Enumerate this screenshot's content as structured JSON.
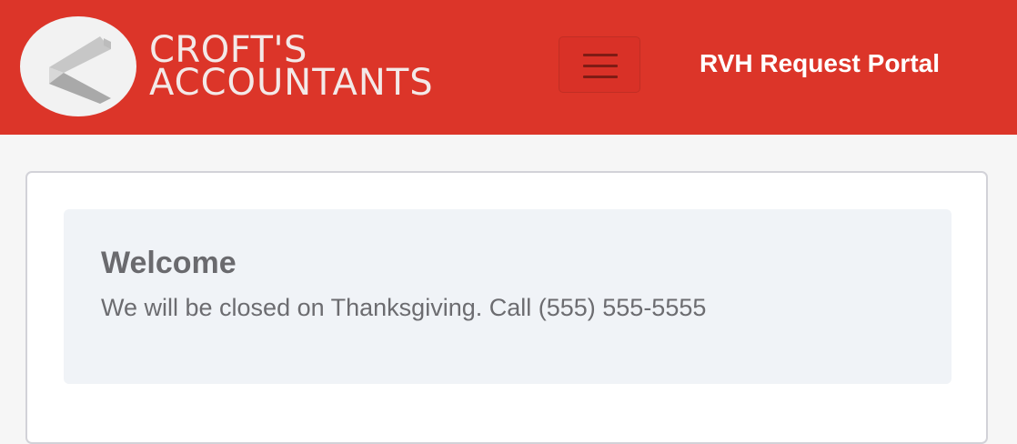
{
  "header": {
    "brand": {
      "line1": "CROFT'S",
      "line2": "ACCOUNTANTS"
    },
    "menu_icon": "hamburger-icon",
    "portal_link": "RVH Request Portal",
    "colors": {
      "navbar": "#dc3529",
      "brand_text": "#f3e9e8",
      "logo_badge": "#f2f2f2"
    }
  },
  "main": {
    "alert": {
      "title": "Welcome",
      "message": "We will be closed on Thanksgiving. Call (555) 555-5555",
      "background": "#f0f3f7"
    }
  }
}
